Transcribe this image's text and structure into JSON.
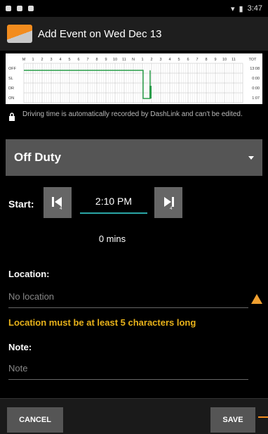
{
  "status_bar": {
    "time": "3:47"
  },
  "app_bar": {
    "title": "Add Event on Wed Dec 13"
  },
  "log_grid": {
    "hour_labels": [
      "M",
      "1",
      "2",
      "3",
      "4",
      "5",
      "6",
      "7",
      "8",
      "9",
      "10",
      "11",
      "N",
      "1",
      "2",
      "3",
      "4",
      "5",
      "6",
      "7",
      "8",
      "9",
      "10",
      "11",
      "TOT"
    ],
    "rows": [
      "OFF",
      "SL",
      "DR",
      "ON"
    ],
    "totals": [
      "13:08",
      "0:00",
      "0:00",
      "1:07"
    ]
  },
  "lock_note": "Driving time is automatically recorded by DashLink and can't be edited.",
  "duty_status": {
    "selected": "Off Duty"
  },
  "start": {
    "label": "Start:",
    "time": "2:10 PM"
  },
  "duration": "0 mins",
  "location": {
    "label": "Location:",
    "placeholder": "No location",
    "error": "Location must be at least 5 characters long"
  },
  "note": {
    "label": "Note:",
    "placeholder": "Note"
  },
  "buttons": {
    "cancel": "CANCEL",
    "save": "SAVE"
  }
}
